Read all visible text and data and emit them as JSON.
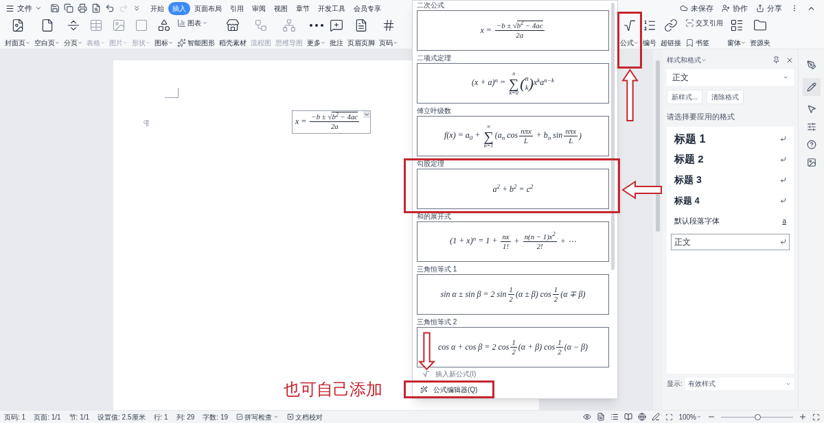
{
  "menu_bar": {
    "file_menu": "文件",
    "tabs": [
      {
        "label": "开始",
        "selected": false
      },
      {
        "label": "插入",
        "selected": true
      },
      {
        "label": "页面布局",
        "selected": false
      },
      {
        "label": "引用",
        "selected": false
      },
      {
        "label": "审阅",
        "selected": false
      },
      {
        "label": "视图",
        "selected": false
      },
      {
        "label": "章节",
        "selected": false
      },
      {
        "label": "开发工具",
        "selected": false
      },
      {
        "label": "会员专享",
        "selected": false
      }
    ],
    "actions": [
      "未保存",
      "协作",
      "分享"
    ]
  },
  "ribbon": {
    "left": [
      {
        "kind": "large",
        "label": "封面页",
        "menu": true,
        "disabled": false
      },
      {
        "kind": "large",
        "label": "空白页",
        "menu": true,
        "disabled": false
      },
      {
        "kind": "large",
        "label": "分页",
        "menu": true,
        "disabled": false
      },
      {
        "kind": "large",
        "label": "表格",
        "menu": true,
        "disabled": true
      },
      {
        "kind": "large",
        "label": "图片",
        "menu": true,
        "disabled": true
      },
      {
        "kind": "large",
        "label": "形状",
        "menu": true,
        "disabled": true
      },
      {
        "kind": "large",
        "label": "图标",
        "menu": true,
        "disabled": false
      },
      {
        "kind": "pair",
        "top": "图表",
        "top_menu": true,
        "bottom": "智能图形"
      },
      {
        "kind": "large",
        "label": "稻壳素材",
        "menu": false,
        "disabled": false
      },
      {
        "kind": "large",
        "label": "流程图",
        "menu": false,
        "disabled": true
      },
      {
        "kind": "large",
        "label": "思维导图",
        "menu": false,
        "disabled": true
      },
      {
        "kind": "large",
        "label": "更多",
        "menu": true,
        "disabled": false
      },
      {
        "kind": "large",
        "label": "批注",
        "menu": false,
        "disabled": false
      },
      {
        "kind": "large",
        "label": "页眉页脚",
        "menu": false,
        "disabled": false
      },
      {
        "kind": "large",
        "label": "页码",
        "menu": true,
        "disabled": false
      }
    ],
    "right": [
      {
        "kind": "large",
        "label": "公式",
        "menu": true,
        "disabled": false
      },
      {
        "kind": "large",
        "label": "编号",
        "menu": false,
        "disabled": false
      },
      {
        "kind": "large",
        "label": "超链接",
        "menu": false,
        "disabled": false
      },
      {
        "kind": "pair",
        "top": "交叉引用",
        "top_menu": false,
        "bottom": "书签"
      },
      {
        "kind": "large",
        "label": "窗体",
        "menu": true,
        "disabled": false
      },
      {
        "kind": "large",
        "label": "资源夹",
        "menu": false,
        "disabled": false
      }
    ]
  },
  "document": {
    "equation": [
      {
        "kind": "text",
        "text": "x = "
      },
      {
        "kind": "frac",
        "num": [
          {
            "kind": "text",
            "text": "−b ± "
          },
          {
            "kind": "sqrt",
            "sign": "√",
            "body": "b$^{2}$ − 4ac"
          }
        ],
        "den": [
          {
            "kind": "text",
            "text": "2a"
          }
        ]
      }
    ]
  },
  "formula_menu": {
    "items": [
      {
        "label": "二次公式",
        "formula": [
          {
            "kind": "text",
            "text": "x = "
          },
          {
            "kind": "frac",
            "num": [
              {
                "kind": "text",
                "text": "−b ± "
              },
              {
                "kind": "sqrt",
                "sign": "√",
                "body": "b$^{2}$ − 4ac"
              }
            ],
            "den": [
              {
                "kind": "text",
                "text": "2a"
              }
            ]
          }
        ]
      },
      {
        "label": "二项式定理",
        "formula": [
          {
            "kind": "text",
            "text": "(x + a)$^{n}$ = "
          },
          {
            "kind": "sum",
            "top": "n",
            "sign": "∑",
            "bottom": "k=0"
          },
          {
            "kind": "binom",
            "open": "(",
            "top": "n",
            "bottom": "k",
            "close": ")"
          },
          {
            "kind": "text",
            "text": "x$^{k}$a$^{n−k}$"
          }
        ]
      },
      {
        "label": "傅立叶级数",
        "formula": [
          {
            "kind": "text",
            "text": "f(x) = a$_{0}$ + "
          },
          {
            "kind": "sum",
            "top": "∞",
            "sign": "∑",
            "bottom": "n=1"
          },
          {
            "kind": "text",
            "text": "(a$_{n}$ cos"
          },
          {
            "kind": "frac",
            "num": [
              {
                "kind": "text",
                "text": "nπx"
              }
            ],
            "den": [
              {
                "kind": "text",
                "text": "L"
              }
            ]
          },
          {
            "kind": "text",
            "text": " + b$_{n}$ sin"
          },
          {
            "kind": "frac",
            "num": [
              {
                "kind": "text",
                "text": "nπx"
              }
            ],
            "den": [
              {
                "kind": "text",
                "text": "L"
              }
            ]
          },
          {
            "kind": "text",
            "text": ")"
          }
        ]
      },
      {
        "label": "勾股定理",
        "formula": [
          {
            "kind": "text",
            "text": "a$^{2}$ + b$^{2}$ = c$^{2}$"
          }
        ]
      },
      {
        "label": "和的展开式",
        "formula": [
          {
            "kind": "text",
            "text": "(1 + x)$^{n}$ = 1 + "
          },
          {
            "kind": "frac",
            "num": [
              {
                "kind": "text",
                "text": "nx"
              }
            ],
            "den": [
              {
                "kind": "text",
                "text": "1!"
              }
            ]
          },
          {
            "kind": "text",
            "text": " + "
          },
          {
            "kind": "frac",
            "num": [
              {
                "kind": "text",
                "text": "n(n − 1)x$^{2}$"
              }
            ],
            "den": [
              {
                "kind": "text",
                "text": "2!"
              }
            ]
          },
          {
            "kind": "text",
            "text": " + ⋯"
          }
        ]
      },
      {
        "label": "三角恒等式 1",
        "formula": [
          {
            "kind": "text",
            "text": "sin α ± sin β = 2 sin"
          },
          {
            "kind": "frac",
            "num": [
              {
                "kind": "text",
                "text": "1"
              }
            ],
            "den": [
              {
                "kind": "text",
                "text": "2"
              }
            ]
          },
          {
            "kind": "text",
            "text": "(α ± β) cos"
          },
          {
            "kind": "frac",
            "num": [
              {
                "kind": "text",
                "text": "1"
              }
            ],
            "den": [
              {
                "kind": "text",
                "text": "2"
              }
            ]
          },
          {
            "kind": "text",
            "text": "(α ∓ β)"
          }
        ]
      },
      {
        "label": "三角恒等式 2",
        "formula": [
          {
            "kind": "text",
            "text": "cos α + cos β = 2 cos"
          },
          {
            "kind": "frac",
            "num": [
              {
                "kind": "text",
                "text": "1"
              }
            ],
            "den": [
              {
                "kind": "text",
                "text": "2"
              }
            ]
          },
          {
            "kind": "text",
            "text": "(α + β) cos"
          },
          {
            "kind": "frac",
            "num": [
              {
                "kind": "text",
                "text": "1"
              }
            ],
            "den": [
              {
                "kind": "text",
                "text": "2"
              }
            ]
          },
          {
            "kind": "text",
            "text": "(α − β)"
          }
        ]
      }
    ],
    "commands": [
      {
        "label": "插入新公式(I)",
        "disabled": true
      },
      {
        "label": "公式编辑器(Q)",
        "disabled": false
      }
    ]
  },
  "styles_pane": {
    "title": "样式和格式",
    "current_style": "正文",
    "buttons": [
      "新样式...",
      "清除格式"
    ],
    "prompt": "请选择要应用的格式",
    "styles": [
      {
        "kind": "heading",
        "label": "标题 1",
        "selected": false
      },
      {
        "kind": "heading",
        "label": "标题 2",
        "selected": false
      },
      {
        "kind": "heading",
        "label": "标题 3",
        "selected": false
      },
      {
        "kind": "heading",
        "label": "标题 4",
        "selected": false
      },
      {
        "kind": "character",
        "label": "默认段落字体",
        "mark": "a",
        "selected": false
      },
      {
        "kind": "paragraph",
        "label": "正文",
        "selected": true
      }
    ],
    "show_label": "显示:",
    "show_value": "有效样式"
  },
  "annotation": {
    "text": "也可自己添加"
  },
  "status_bar": {
    "items": [
      "页码: 1",
      "页面: 1/1",
      "节: 1/1",
      "设置值: 2.5厘米",
      "行: 1",
      "列: 29",
      "字数: 19"
    ],
    "spell_check": "拼写检查",
    "proofread": "文档校对",
    "zoom": "100%",
    "zoom_slider": {
      "level": 0.5
    }
  }
}
